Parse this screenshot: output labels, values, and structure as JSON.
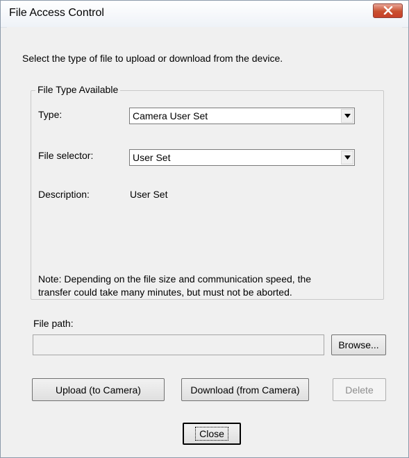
{
  "window": {
    "title": "File Access Control"
  },
  "instruction": "Select the type of file to upload or download from the device.",
  "group": {
    "label": "File Type Available",
    "type_label": "Type:",
    "type_value": "Camera User Set",
    "selector_label": "File selector:",
    "selector_value": "User Set",
    "description_label": "Description:",
    "description_value": "User Set",
    "note_line1": "Note: Depending on the file size and communication speed, the",
    "note_line2": "transfer could take many minutes, but must not be aborted."
  },
  "file_path": {
    "label": "File path:",
    "value": ""
  },
  "buttons": {
    "browse": "Browse...",
    "upload": "Upload (to Camera)",
    "download": "Download (from Camera)",
    "delete": "Delete",
    "close": "Close"
  },
  "icons": {
    "close": "close-x-icon",
    "dropdown": "dropdown-arrow-icon"
  }
}
